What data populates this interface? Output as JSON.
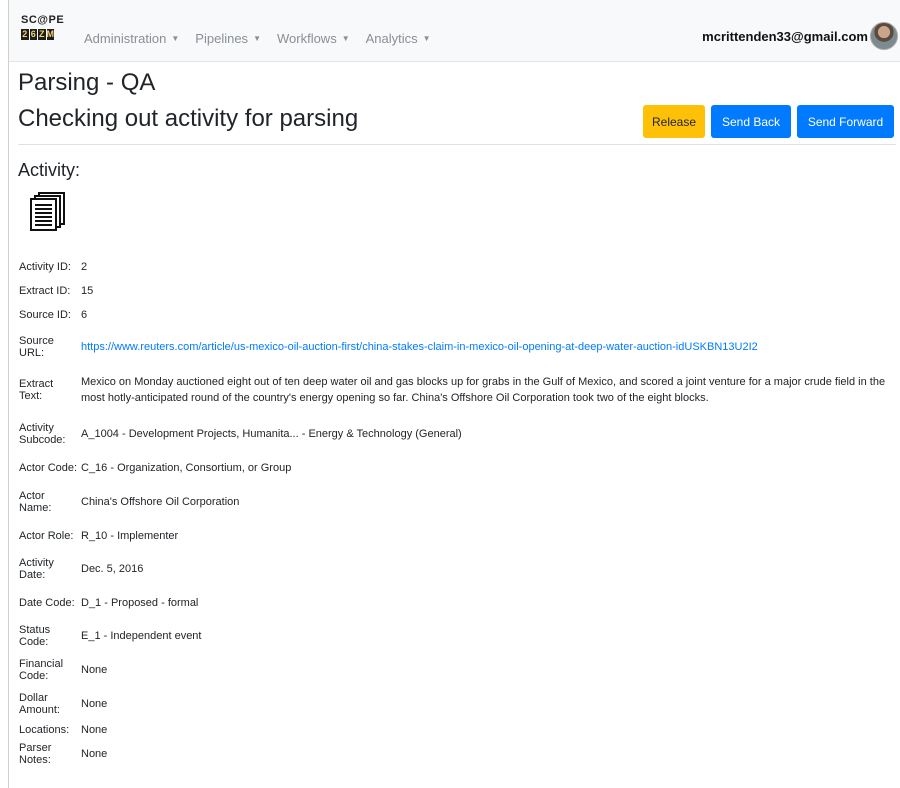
{
  "navbar": {
    "logo": {
      "top": "SC@PE",
      "bottom": [
        "2",
        "6",
        "Z",
        "M"
      ]
    },
    "menu": [
      {
        "label": "Administration"
      },
      {
        "label": "Pipelines"
      },
      {
        "label": "Workflows"
      },
      {
        "label": "Analytics"
      }
    ],
    "user_email": "mcrittenden33@gmail.com"
  },
  "header": {
    "title": "Parsing - QA",
    "subtitle": "Checking out activity for parsing"
  },
  "actions": {
    "release": "Release",
    "send_back": "Send Back",
    "send_forward": "Send Forward"
  },
  "activity": {
    "heading": "Activity:",
    "icon": "documents-icon",
    "fields": [
      {
        "label": "Activity ID:",
        "value": "2"
      },
      {
        "label": "Extract ID:",
        "value": "15"
      },
      {
        "label": "Source ID:",
        "value": "6"
      },
      {
        "label": "Source URL:",
        "value": "https://www.reuters.com/article/us-mexico-oil-auction-first/china-stakes-claim-in-mexico-oil-opening-at-deep-water-auction-idUSKBN13U2I2"
      },
      {
        "label": "Extract Text:",
        "value": "Mexico on Monday auctioned eight out of ten deep water oil and gas blocks up for grabs in the Gulf of Mexico, and scored a joint venture for a major crude field in the most hotly-anticipated round of the country's energy opening so far. China's Offshore Oil Corporation took two of the eight blocks."
      },
      {
        "label": "Activity Subcode:",
        "value": "A_1004 - Development Projects, Humanita... - Energy & Technology (General)"
      },
      {
        "label": "Actor Code:",
        "value": "C_16 - Organization, Consortium, or Group"
      },
      {
        "label": "Actor Name:",
        "value": "China's Offshore Oil Corporation"
      },
      {
        "label": "Actor Role:",
        "value": "R_10 - Implementer"
      },
      {
        "label": "Activity Date:",
        "value": "Dec. 5, 2016"
      },
      {
        "label": "Date Code:",
        "value": "D_1 - Proposed - formal"
      },
      {
        "label": "Status Code:",
        "value": "E_1 - Independent event"
      },
      {
        "label": "Financial Code:",
        "value": "None"
      },
      {
        "label": "Dollar Amount:",
        "value": "None"
      },
      {
        "label": "Locations:",
        "value": "None"
      },
      {
        "label": "Parser Notes:",
        "value": "None"
      }
    ]
  },
  "colors": {
    "primary": "#007bff",
    "warning": "#ffc107",
    "navbar_bg": "#f8f9fa",
    "link": "#007bff"
  }
}
